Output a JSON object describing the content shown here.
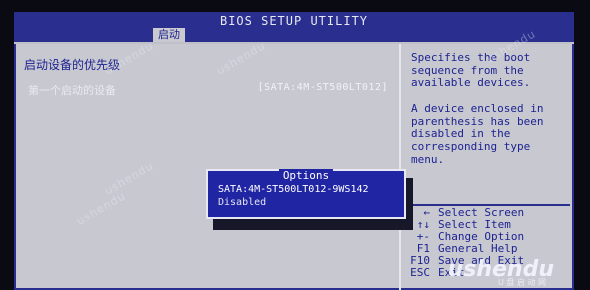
{
  "title": "BIOS SETUP UTILITY",
  "tab_label": "启动",
  "section_heading": "启动设备的优先级",
  "boot_item": {
    "label": "第一个启动的设备",
    "value": "[SATA:4M-ST500LT012]"
  },
  "help_text": "Specifies the boot sequence from the available devices.\n\nA device enclosed in parenthesis has been disabled in the corresponding type menu.",
  "keys": [
    {
      "key": "←",
      "desc": "Select Screen"
    },
    {
      "key": "↑↓",
      "desc": "Select Item"
    },
    {
      "key": "+-",
      "desc": "Change Option"
    },
    {
      "key": "F1",
      "desc": "General Help"
    },
    {
      "key": "F10",
      "desc": "Save and Exit"
    },
    {
      "key": "ESC",
      "desc": "Exit"
    }
  ],
  "popup": {
    "title": "Options",
    "options": [
      "SATA:4M-ST500LT012-9WS142",
      "Disabled"
    ]
  },
  "watermark": {
    "logo": "ushendu",
    "sub": "U 盘 启 动 网"
  },
  "colors": {
    "bios_blue": "#2a2f8f",
    "panel_gray": "#c8c8d0",
    "text_blue": "#1d2390"
  }
}
